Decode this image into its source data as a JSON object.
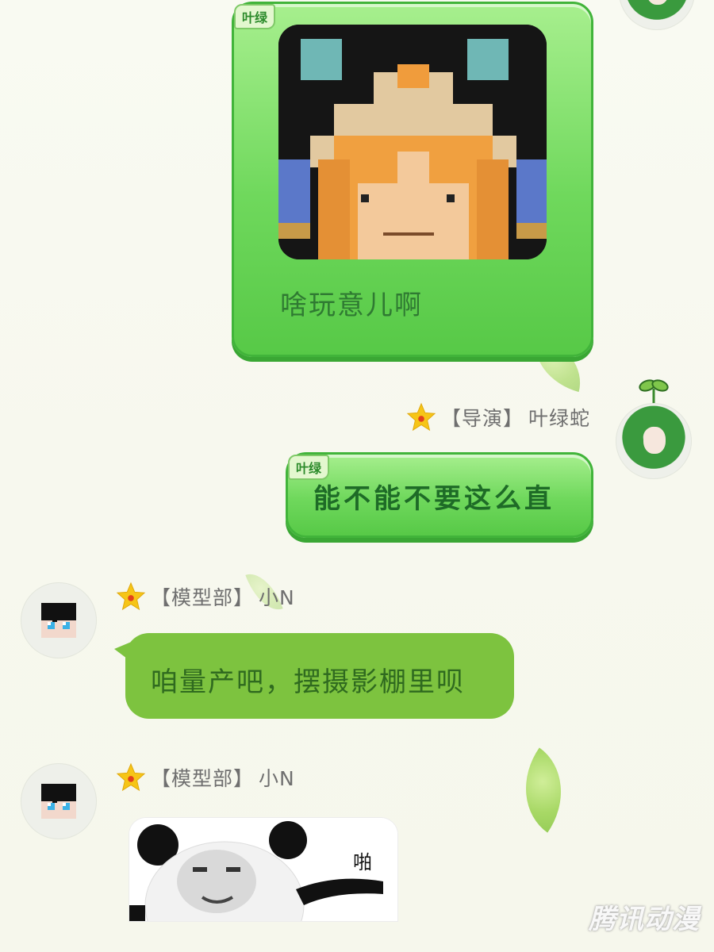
{
  "messages": [
    {
      "side": "right",
      "tag": "叶绿",
      "caption": "啥玩意儿啊",
      "image": "pixel-character-face"
    },
    {
      "side": "right",
      "sender_role": "【导演】",
      "sender_name": "叶绿蛇",
      "tag": "叶绿",
      "text": "能不能不要这么直"
    },
    {
      "side": "left",
      "sender_role": "【模型部】",
      "sender_name": "小N",
      "text": "咱量产吧，摆摄影棚里呗"
    },
    {
      "side": "left",
      "sender_role": "【模型部】",
      "sender_name": "小N",
      "sticker_text": "啪",
      "image": "panda-meme-sticker"
    }
  ],
  "watermark": "腾讯动漫",
  "icons": {
    "star": "star-icon",
    "sprout": "sprout-icon"
  },
  "colors": {
    "bubble_green": "#6fd85c",
    "bubble_border": "#41b43a",
    "bubble_plain": "#7dc33f",
    "text_green": "#2f7a32",
    "star": "#f6c517"
  }
}
